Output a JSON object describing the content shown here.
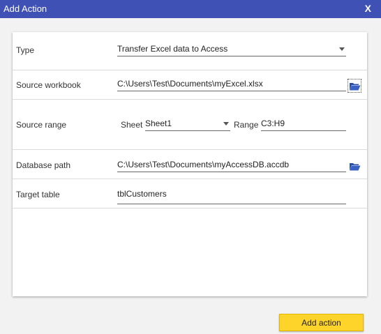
{
  "window": {
    "title": "Add Action",
    "close_label": "X"
  },
  "form": {
    "type": {
      "label": "Type",
      "value": "Transfer Excel data to Access"
    },
    "source_workbook": {
      "label": "Source workbook",
      "value": "C:\\Users\\Test\\Documents\\myExcel.xlsx"
    },
    "source_range": {
      "label": "Source range",
      "sheet_label": "Sheet",
      "sheet_value": "Sheet1",
      "range_label": "Range",
      "range_value": "C3:H9"
    },
    "database_path": {
      "label": "Database path",
      "value": "C:\\Users\\Test\\Documents\\myAccessDB.accdb"
    },
    "target_table": {
      "label": "Target table",
      "value": "tblCustomers"
    }
  },
  "actions": {
    "add_action_label": "Add action"
  },
  "icons": {
    "browse": "folder-open-icon"
  },
  "colors": {
    "titlebar": "#3f51b5",
    "primary_button": "#ffd42a",
    "folder_icon": "#2b4fa8"
  }
}
